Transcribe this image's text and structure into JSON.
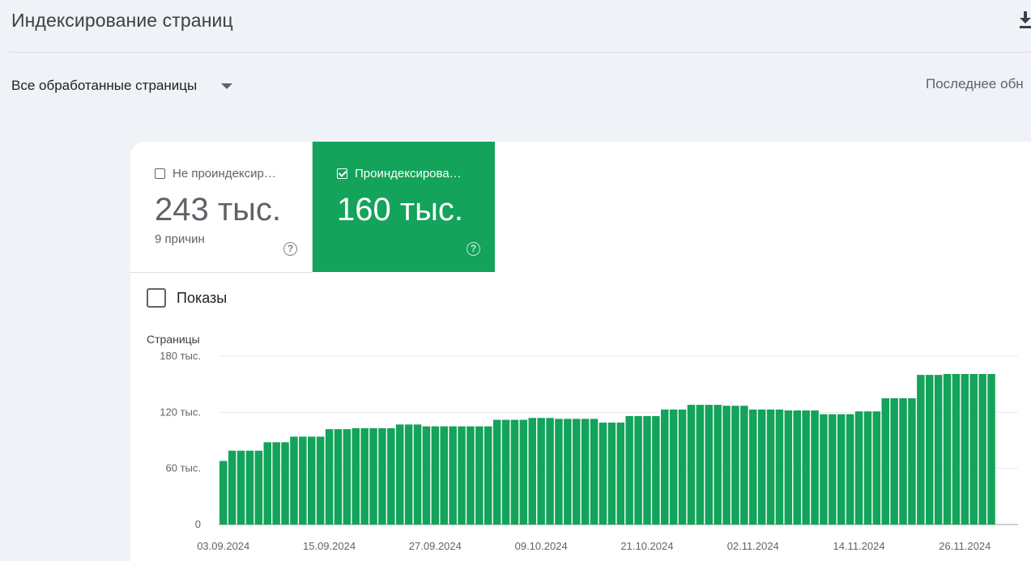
{
  "header": {
    "title": "Индексирование страниц",
    "download_icon": "download-icon"
  },
  "filter": {
    "selected": "Все обработанные страницы",
    "last_update_label": "Последнее обн"
  },
  "tabs": [
    {
      "label": "Не проиндексир…",
      "value": "243 тыс.",
      "sub": "9 причин",
      "checked": false
    },
    {
      "label": "Проиндексирова…",
      "value": "160 тыс.",
      "sub": "",
      "checked": true
    }
  ],
  "toggle": {
    "label": "Показы",
    "checked": false
  },
  "colors": {
    "accent": "#13a35a",
    "bar": "#13a35a",
    "grid": "#e8eaed"
  },
  "chart_data": {
    "type": "bar",
    "ylabel": "Страницы",
    "ylim": [
      0,
      180000
    ],
    "yticks": [
      0,
      60000,
      120000,
      180000
    ],
    "ytick_labels": [
      "0",
      "60 тыс.",
      "120 тыс.",
      "180 тыс."
    ],
    "xtick_labels": [
      "03.09.2024",
      "15.09.2024",
      "27.09.2024",
      "09.10.2024",
      "21.10.2024",
      "02.11.2024",
      "14.11.2024",
      "26.11.2024"
    ],
    "grid": true,
    "categories": [
      "03.09.2024",
      "04.09.2024",
      "05.09.2024",
      "06.09.2024",
      "07.09.2024",
      "08.09.2024",
      "09.09.2024",
      "10.09.2024",
      "11.09.2024",
      "12.09.2024",
      "13.09.2024",
      "14.09.2024",
      "15.09.2024",
      "16.09.2024",
      "17.09.2024",
      "18.09.2024",
      "19.09.2024",
      "20.09.2024",
      "21.09.2024",
      "22.09.2024",
      "23.09.2024",
      "24.09.2024",
      "25.09.2024",
      "26.09.2024",
      "27.09.2024",
      "28.09.2024",
      "29.09.2024",
      "30.09.2024",
      "01.10.2024",
      "02.10.2024",
      "03.10.2024",
      "04.10.2024",
      "05.10.2024",
      "06.10.2024",
      "07.10.2024",
      "08.10.2024",
      "09.10.2024",
      "10.10.2024",
      "11.10.2024",
      "12.10.2024",
      "13.10.2024",
      "14.10.2024",
      "15.10.2024",
      "16.10.2024",
      "17.10.2024",
      "18.10.2024",
      "19.10.2024",
      "20.10.2024",
      "21.10.2024",
      "22.10.2024",
      "23.10.2024",
      "24.10.2024",
      "25.10.2024",
      "26.10.2024",
      "27.10.2024",
      "28.10.2024",
      "29.10.2024",
      "30.10.2024",
      "31.10.2024",
      "01.11.2024",
      "02.11.2024",
      "03.11.2024",
      "04.11.2024",
      "05.11.2024",
      "06.11.2024",
      "07.11.2024",
      "08.11.2024",
      "09.11.2024",
      "10.11.2024",
      "11.11.2024",
      "12.11.2024",
      "13.11.2024",
      "14.11.2024",
      "15.11.2024",
      "16.11.2024",
      "17.11.2024",
      "18.11.2024",
      "19.11.2024",
      "20.11.2024",
      "21.11.2024",
      "22.11.2024",
      "23.11.2024",
      "24.11.2024",
      "25.11.2024",
      "26.11.2024",
      "27.11.2024",
      "28.11.2024",
      "29.11.2024"
    ],
    "values": [
      68000,
      79000,
      79000,
      79000,
      79000,
      88000,
      88000,
      88000,
      94000,
      94000,
      94000,
      94000,
      102000,
      102000,
      102000,
      103000,
      103000,
      103000,
      103000,
      103000,
      107000,
      107000,
      107000,
      105000,
      105000,
      105000,
      105000,
      105000,
      105000,
      105000,
      105000,
      112000,
      112000,
      112000,
      112000,
      114000,
      114000,
      114000,
      113000,
      113000,
      113000,
      113000,
      113000,
      109000,
      109000,
      109000,
      116000,
      116000,
      116000,
      116000,
      123000,
      123000,
      123000,
      128000,
      128000,
      128000,
      128000,
      127000,
      127000,
      127000,
      123000,
      123000,
      123000,
      123000,
      122000,
      122000,
      122000,
      122000,
      118000,
      118000,
      118000,
      118000,
      121000,
      121000,
      121000,
      135000,
      135000,
      135000,
      135000,
      160000,
      160000,
      160000,
      161000,
      161000,
      161000,
      161000,
      161000,
      161000
    ]
  }
}
